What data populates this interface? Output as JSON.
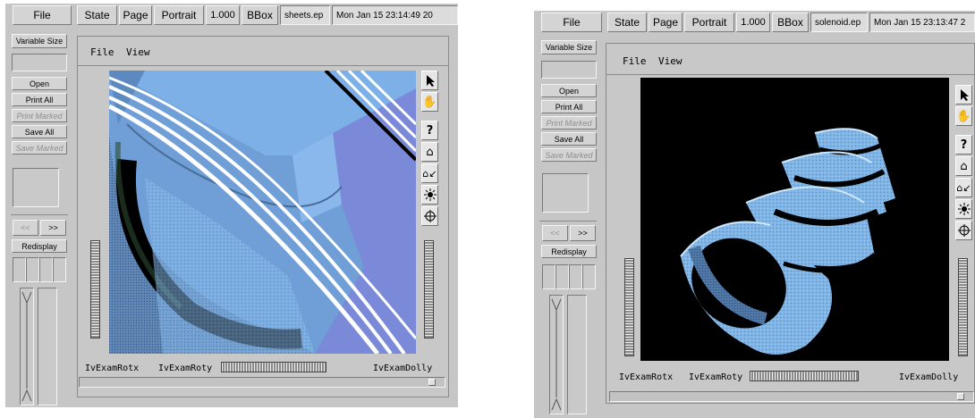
{
  "left": {
    "file_button": "File",
    "state_button": "State",
    "page_button": "Page",
    "orientation_button": "Portrait",
    "scale_value": "1.000",
    "bbox_button": "BBox",
    "filename": "sheets.ep",
    "timestamp": "Mon Jan 15 23:14:49 20",
    "variable_size_button": "Variable Size",
    "open_button": "Open",
    "print_all_button": "Print All",
    "print_marked_button": "Print Marked",
    "save_all_button": "Save All",
    "save_marked_button": "Save Marked",
    "prev_button": "<<",
    "next_button": ">>",
    "redisplay_button": "Redisplay",
    "viewer_menu_file": "File",
    "viewer_menu_view": "View",
    "rotx_label": "IvExamRotx",
    "roty_label": "IvExamRoty",
    "dolly_label": "IvExamDolly"
  },
  "right": {
    "file_button": "File",
    "state_button": "State",
    "page_button": "Page",
    "orientation_button": "Portrait",
    "scale_value": "1.000",
    "bbox_button": "BBox",
    "filename": "solenoid.ep",
    "timestamp": "Mon Jan 15 23:13:47 2",
    "variable_size_button": "Variable Size",
    "open_button": "Open",
    "print_all_button": "Print All",
    "print_marked_button": "Print Marked",
    "save_all_button": "Save All",
    "save_marked_button": "Save Marked",
    "prev_button": "<<",
    "next_button": ">>",
    "redisplay_button": "Redisplay",
    "viewer_menu_file": "File",
    "viewer_menu_view": "View",
    "rotx_label": "IvExamRotx",
    "roty_label": "IvExamRoty",
    "dolly_label": "IvExamDolly"
  },
  "icons": {
    "viewer_tools": [
      "pointer-arrow-icon",
      "hand-icon",
      "help-question-icon",
      "home-icon",
      "set-home-icon",
      "view-all-eye-icon",
      "seek-crosshair-icon"
    ]
  },
  "colors": {
    "window_bg": "#c6c6c6",
    "viewport_black": "#000000",
    "surface_blue": "#7fb4e4"
  }
}
